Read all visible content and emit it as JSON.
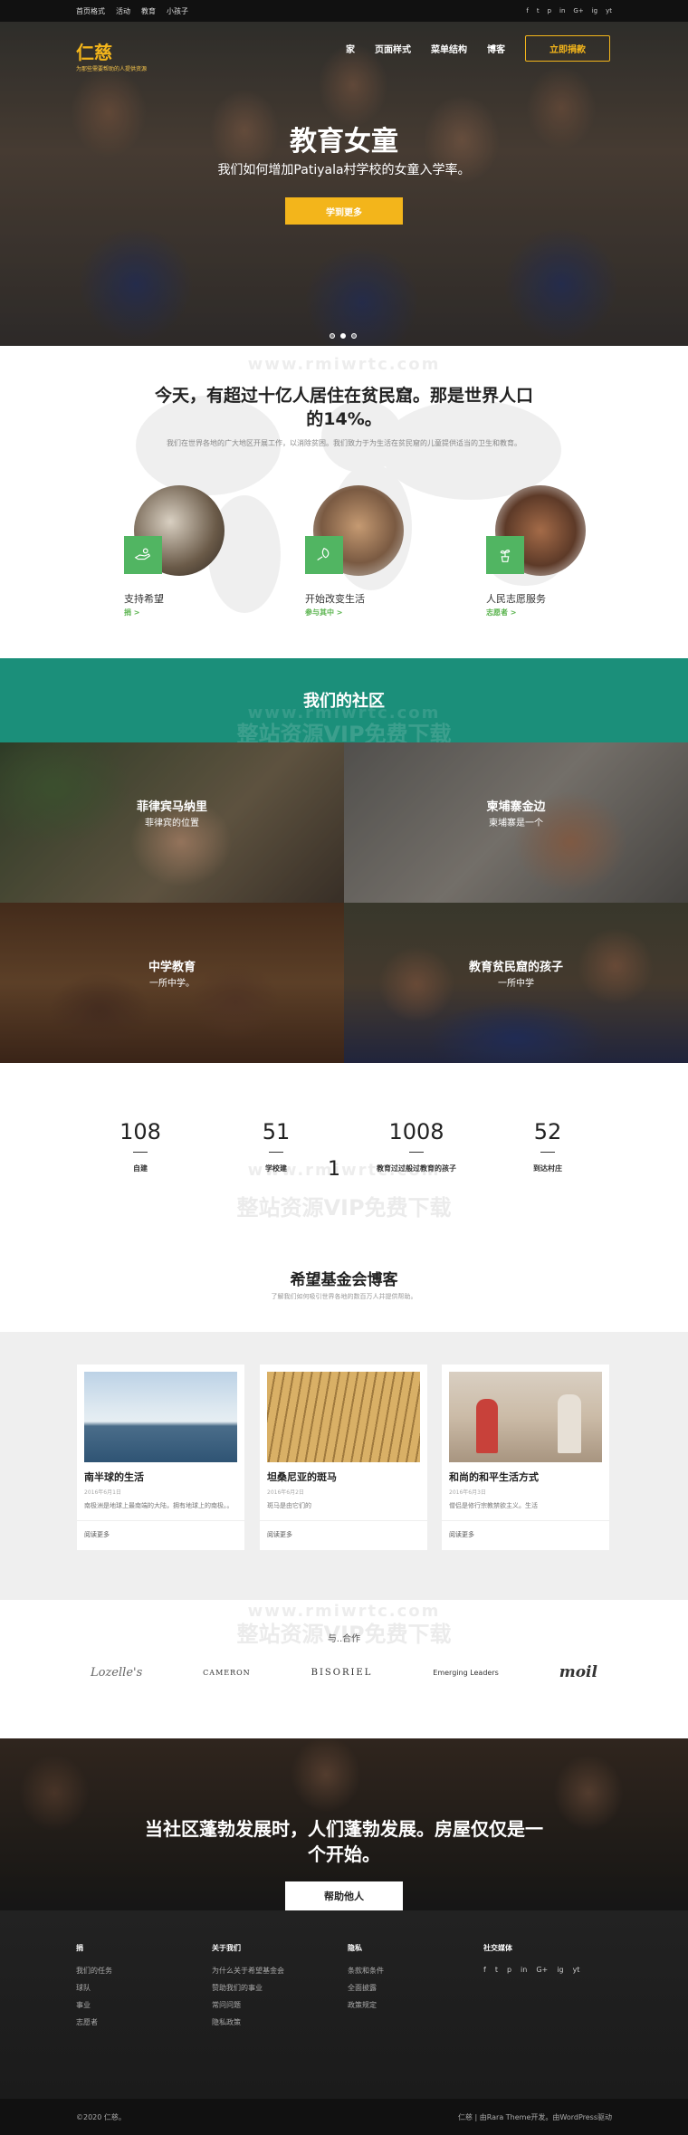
{
  "topbar": {
    "links": [
      "首页格式",
      "活动",
      "教育",
      "小孩子"
    ],
    "socials": [
      "f",
      "t",
      "p",
      "in",
      "G+",
      "ig",
      "yt"
    ]
  },
  "header": {
    "logo": "仁慈",
    "tagline": "为那些需要帮助的人提供资源",
    "nav": [
      "家",
      "页面样式",
      "菜单结构",
      "博客"
    ],
    "donate_label": "立即捐款"
  },
  "hero": {
    "title": "教育女童",
    "subtitle": "我们如何增加Patiyala村学校的女童入学率。",
    "button": "学到更多"
  },
  "watermarks": {
    "site": "www.rmiwrtc.com",
    "cn": "整站资源VIP免费下载"
  },
  "mission": {
    "title": "今天，有超过十亿人居住在贫民窟。那是世界人口的14%。",
    "desc": "我们在世界各地的广大地区开展工作，以消除贫困。我们致力于为生活在贫民窟的儿童提供适当的卫生和教育。",
    "features": [
      {
        "title": "支持希望",
        "link": "捐 >"
      },
      {
        "title": "开始改变生活",
        "link": "参与其中 >"
      },
      {
        "title": "人民志愿服务",
        "link": "志愿者 >"
      }
    ]
  },
  "community": {
    "title": "我们的社区",
    "tiles": [
      {
        "title": "菲律宾马纳里",
        "sub": "菲律宾的位置"
      },
      {
        "title": "柬埔寨金边",
        "sub": "柬埔寨是一个"
      },
      {
        "title": "中学教育",
        "sub": "一所中学。"
      },
      {
        "title": "教育贫民窟的孩子",
        "sub": "一所中学"
      }
    ]
  },
  "stats": [
    {
      "num": "108",
      "label": "自建"
    },
    {
      "num": "51",
      "label": "学校建"
    },
    {
      "num": "1008",
      "label": "教育过过般过教育的孩子"
    },
    {
      "num": "52",
      "label": "到达村庄"
    }
  ],
  "stats_extra": "1",
  "blog": {
    "title": "希望基金会博客",
    "sub": "了解我们如何吸引世界各地的数百万人并提供帮助。",
    "posts": [
      {
        "title": "南半球的生活",
        "date": "2016年6月1日",
        "excerpt": "南极洲是地球上最南端的大陆，拥有地球上的南极。。",
        "more": "阅读更多"
      },
      {
        "title": "坦桑尼亚的斑马",
        "date": "2016年6月2日",
        "excerpt": "斑马是由它们的",
        "more": "阅读更多"
      },
      {
        "title": "和尚的和平生活方式",
        "date": "2016年6月3日",
        "excerpt": "僧侣是修行宗教禁欲主义。生活",
        "more": "阅读更多"
      }
    ]
  },
  "partners": {
    "title": "与..合作",
    "logos": [
      "Lozelle's",
      "CAMERON",
      "BISORIEL",
      "Emerging Leaders",
      "moil"
    ]
  },
  "cta": {
    "title": "当社区蓬勃发展时，人们蓬勃发展。房屋仅仅是一个开始。",
    "button": "帮助他人"
  },
  "footer": {
    "cols": [
      {
        "title": "捐",
        "items": [
          "我们的任务",
          "球队",
          "事业",
          "志愿者"
        ]
      },
      {
        "title": "关于我们",
        "items": [
          "为什么关于希望基金会",
          "赞助我们的事业",
          "常问问题",
          "隐私政策"
        ]
      },
      {
        "title": "隐私",
        "items": [
          "条款和条件",
          "全面披露",
          "政策规定"
        ]
      },
      {
        "title": "社交媒体",
        "items": []
      }
    ],
    "socials": [
      "f",
      "t",
      "p",
      "in",
      "G+",
      "ig",
      "yt"
    ],
    "copyright": "©2020 仁慈。",
    "credit": "仁慈 | 由Rara Theme开发。由WordPress驱动"
  }
}
